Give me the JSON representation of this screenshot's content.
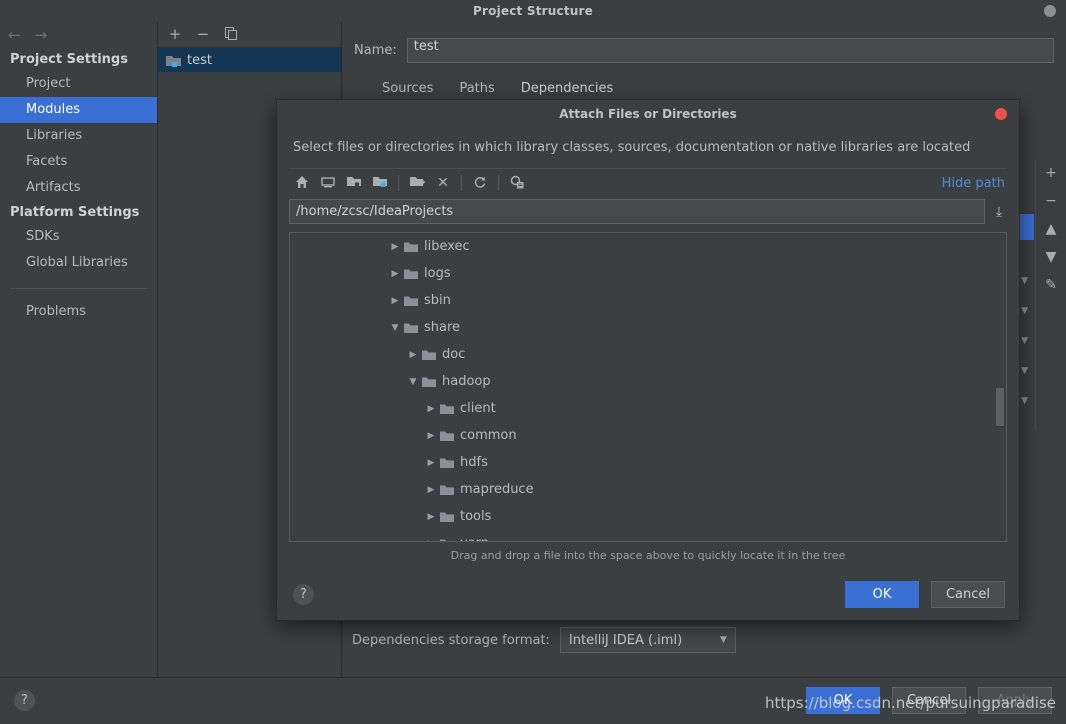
{
  "window": {
    "title": "Project Structure",
    "close_icon": "close-dot"
  },
  "sidebar": {
    "back_icon": "←",
    "forward_icon": "→",
    "sections": [
      {
        "heading": "Project Settings",
        "items": [
          {
            "label": "Project",
            "active": false
          },
          {
            "label": "Modules",
            "active": true
          },
          {
            "label": "Libraries",
            "active": false
          },
          {
            "label": "Facets",
            "active": false
          },
          {
            "label": "Artifacts",
            "active": false
          }
        ]
      },
      {
        "heading": "Platform Settings",
        "items": [
          {
            "label": "SDKs",
            "active": false
          },
          {
            "label": "Global Libraries",
            "active": false
          }
        ]
      }
    ],
    "problems_label": "Problems"
  },
  "modules_panel": {
    "toolbar": [
      {
        "name": "add-module-button",
        "glyph": "+"
      },
      {
        "name": "remove-module-button",
        "glyph": "−"
      },
      {
        "name": "copy-module-button",
        "glyph": "❐"
      }
    ],
    "rows": [
      {
        "label": "test",
        "selected": true
      }
    ]
  },
  "content": {
    "name_label": "Name:",
    "name_value": "test",
    "tabs": [
      {
        "label": "Sources",
        "active": false
      },
      {
        "label": "Paths",
        "active": false
      },
      {
        "label": "Dependencies",
        "active": true
      }
    ],
    "side_toolbar": [
      {
        "name": "add-button",
        "glyph": "+"
      },
      {
        "name": "remove-button",
        "glyph": "−"
      },
      {
        "name": "move-up-button",
        "glyph": "▲"
      },
      {
        "name": "move-down-button",
        "glyph": "▼"
      },
      {
        "name": "edit-button",
        "glyph": "✎"
      }
    ],
    "storage_label": "Dependencies storage format:",
    "storage_value": "IntelliJ IDEA (.iml)",
    "storage_caret": "▼"
  },
  "bottom_bar": {
    "help_label": "?",
    "buttons": [
      {
        "label": "OK",
        "style": "primary"
      },
      {
        "label": "Cancel",
        "style": "normal"
      },
      {
        "label": "Apply",
        "style": "disabled"
      }
    ],
    "watermark": "https://blog.csdn.net/pursuingparadise"
  },
  "dialog": {
    "title": "Attach Files or Directories",
    "close_icon": "close-dot",
    "description": "Select files or directories in which library classes, sources, documentation or native libraries are located",
    "toolbar": [
      {
        "name": "home-icon",
        "glyph": "home"
      },
      {
        "name": "desktop-icon",
        "glyph": "desktop"
      },
      {
        "name": "parent-folder-icon",
        "glyph": "folder-up"
      },
      {
        "name": "project-folder-icon",
        "glyph": "folder-blue"
      },
      {
        "name": "new-folder-icon",
        "glyph": "folder-plus"
      },
      {
        "name": "delete-icon",
        "glyph": "✕"
      },
      {
        "name": "refresh-icon",
        "glyph": "refresh"
      },
      {
        "name": "show-hidden-icon",
        "glyph": "hidden"
      }
    ],
    "hide_path_label": "Hide path",
    "path_value": "/home/zcsc/IdeaProjects",
    "path_dropdown_icon": "⤓",
    "tree": [
      {
        "label": "libexec",
        "depth": 0,
        "state": "collapsed"
      },
      {
        "label": "logs",
        "depth": 0,
        "state": "collapsed"
      },
      {
        "label": "sbin",
        "depth": 0,
        "state": "collapsed"
      },
      {
        "label": "share",
        "depth": 0,
        "state": "expanded"
      },
      {
        "label": "doc",
        "depth": 1,
        "state": "collapsed"
      },
      {
        "label": "hadoop",
        "depth": 1,
        "state": "expanded"
      },
      {
        "label": "client",
        "depth": 2,
        "state": "collapsed"
      },
      {
        "label": "common",
        "depth": 2,
        "state": "collapsed"
      },
      {
        "label": "hdfs",
        "depth": 2,
        "state": "collapsed"
      },
      {
        "label": "mapreduce",
        "depth": 2,
        "state": "collapsed"
      },
      {
        "label": "tools",
        "depth": 2,
        "state": "collapsed"
      },
      {
        "label": "yarn",
        "depth": 2,
        "state": "collapsed"
      }
    ],
    "hint": "Drag and drop a file into the space above to quickly locate it in the tree",
    "help_label": "?",
    "buttons": [
      {
        "label": "OK",
        "style": "primary"
      },
      {
        "label": "Cancel",
        "style": "normal"
      }
    ]
  },
  "colors": {
    "accent_blue": "#3a6fd4",
    "link_blue": "#4b8dd4",
    "close_red": "#f0504a",
    "selection_navy": "#133754",
    "bg": "#3c3f41"
  }
}
